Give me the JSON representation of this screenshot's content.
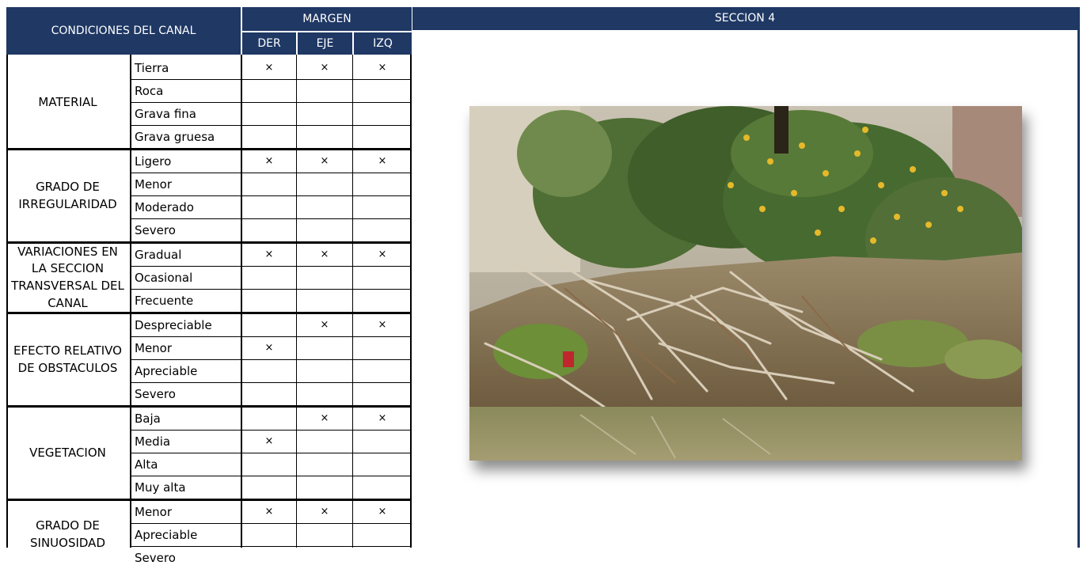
{
  "table": {
    "header": {
      "condition_title": "CONDICIONES DEL CANAL",
      "margin_title": "MARGEN",
      "columns": [
        "DER",
        "EJE",
        "IZQ"
      ]
    },
    "mark_symbol": "×",
    "groups": [
      {
        "label_lines": [
          "MATERIAL"
        ],
        "items": [
          {
            "name": "Tierra",
            "marks": [
              true,
              true,
              true
            ]
          },
          {
            "name": "Roca",
            "marks": [
              false,
              false,
              false
            ]
          },
          {
            "name": "Grava fina",
            "marks": [
              false,
              false,
              false
            ]
          },
          {
            "name": "Grava gruesa",
            "marks": [
              false,
              false,
              false
            ]
          }
        ]
      },
      {
        "label_lines": [
          "GRADO DE",
          "IRREGULARIDAD"
        ],
        "items": [
          {
            "name": "Ligero",
            "marks": [
              true,
              true,
              true
            ]
          },
          {
            "name": "Menor",
            "marks": [
              false,
              false,
              false
            ]
          },
          {
            "name": "Moderado",
            "marks": [
              false,
              false,
              false
            ]
          },
          {
            "name": "Severo",
            "marks": [
              false,
              false,
              false
            ]
          }
        ]
      },
      {
        "label_lines": [
          "VARIACIONES EN",
          "LA SECCION",
          "TRANSVERSAL DEL",
          "CANAL"
        ],
        "items": [
          {
            "name": "Gradual",
            "marks": [
              true,
              true,
              true
            ]
          },
          {
            "name": "Ocasional",
            "marks": [
              false,
              false,
              false
            ]
          },
          {
            "name": "Frecuente",
            "marks": [
              false,
              false,
              false
            ]
          }
        ]
      },
      {
        "label_lines": [
          "EFECTO RELATIVO",
          "DE OBSTACULOS"
        ],
        "items": [
          {
            "name": "Despreciable",
            "marks": [
              false,
              true,
              true
            ]
          },
          {
            "name": "Menor",
            "marks": [
              true,
              false,
              false
            ]
          },
          {
            "name": "Apreciable",
            "marks": [
              false,
              false,
              false
            ]
          },
          {
            "name": "Severo",
            "marks": [
              false,
              false,
              false
            ]
          }
        ]
      },
      {
        "label_lines": [
          "VEGETACION"
        ],
        "items": [
          {
            "name": "Baja",
            "marks": [
              false,
              true,
              true
            ]
          },
          {
            "name": "Media",
            "marks": [
              true,
              false,
              false
            ]
          },
          {
            "name": "Alta",
            "marks": [
              false,
              false,
              false
            ]
          },
          {
            "name": "Muy alta",
            "marks": [
              false,
              false,
              false
            ]
          }
        ]
      },
      {
        "label_lines": [
          "GRADO DE",
          "SINUOSIDAD"
        ],
        "items": [
          {
            "name": "Menor",
            "marks": [
              true,
              true,
              true
            ]
          },
          {
            "name": "Apreciable",
            "marks": [
              false,
              false,
              false
            ]
          },
          {
            "name": "Severo",
            "marks": [
              false,
              false,
              false
            ]
          }
        ]
      }
    ]
  },
  "section": {
    "title": "SECCION 4"
  },
  "colors": {
    "header_bg": "#1f3864",
    "header_text": "#ffffff",
    "grid": "#000000"
  }
}
